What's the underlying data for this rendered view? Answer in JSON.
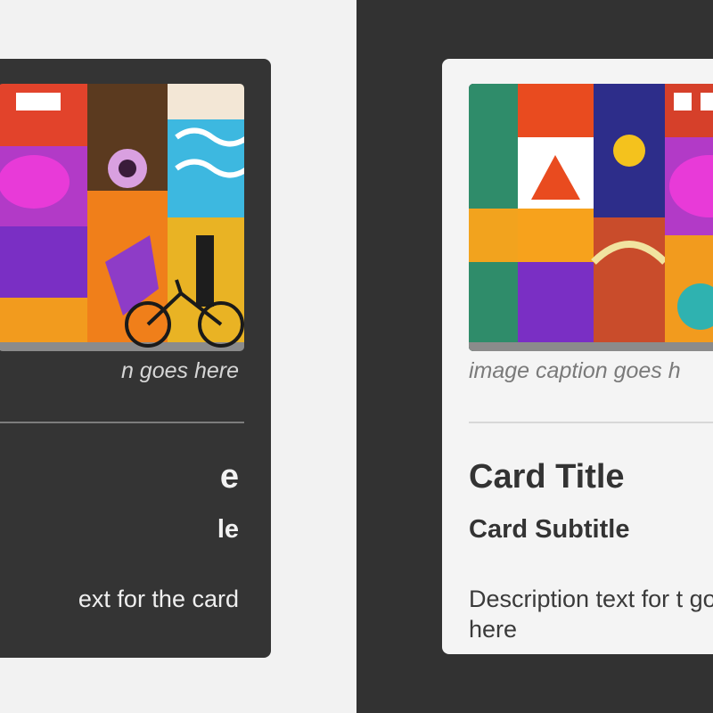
{
  "cards": [
    {
      "theme": "dark",
      "caption": "n goes here",
      "title": "e",
      "subtitle": "le",
      "description": "ext for the card"
    },
    {
      "theme": "light",
      "caption": "image caption goes h",
      "title": "Card Title",
      "subtitle": "Card Subtitle",
      "description": "Description text for t goes here"
    }
  ],
  "colors": {
    "light_bg": "#f2f2f2",
    "dark_bg": "#323232",
    "dark_card": "#343434",
    "light_card": "#f4f4f4"
  }
}
